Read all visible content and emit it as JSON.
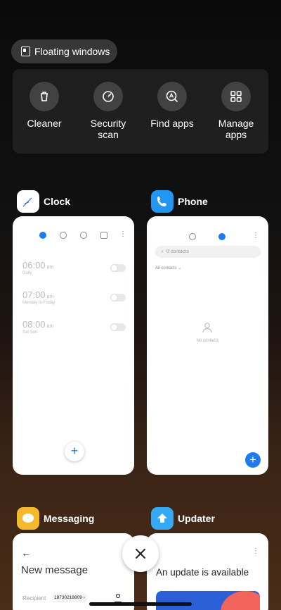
{
  "floating_windows": {
    "label": "Floating windows"
  },
  "tools": [
    {
      "label": "Cleaner",
      "icon": "trash-icon"
    },
    {
      "label": "Security scan",
      "icon": "security-scan-icon"
    },
    {
      "label": "Find apps",
      "icon": "find-apps-icon"
    },
    {
      "label": "Manage apps",
      "icon": "manage-apps-icon"
    }
  ],
  "apps": {
    "clock": {
      "name": "Clock",
      "alarms": [
        {
          "time": "06:00",
          "ampm": "am",
          "repeat": "Daily"
        },
        {
          "time": "07:00",
          "ampm": "am",
          "repeat": "Monday to Friday"
        },
        {
          "time": "08:00",
          "ampm": "am",
          "repeat": "Sat Sun"
        }
      ],
      "fab": "+"
    },
    "phone": {
      "name": "Phone",
      "search_placeholder": "0 contacts",
      "filter": "All contacts",
      "empty_text": "No contacts",
      "fab": "+"
    },
    "messaging": {
      "name": "Messaging",
      "title": "New message",
      "recipient_label": "Recipient",
      "recipient_value": "18730218809"
    },
    "updater": {
      "name": "Updater",
      "headline": "An update is available"
    }
  },
  "colors": {
    "accent": "#1d7cf2",
    "clock_icon_bg": "#ffffff",
    "phone_icon_bg": "#2196f3",
    "messaging_icon_bg": "#f5b92e",
    "updater_icon_bg": "#36a9f4"
  }
}
